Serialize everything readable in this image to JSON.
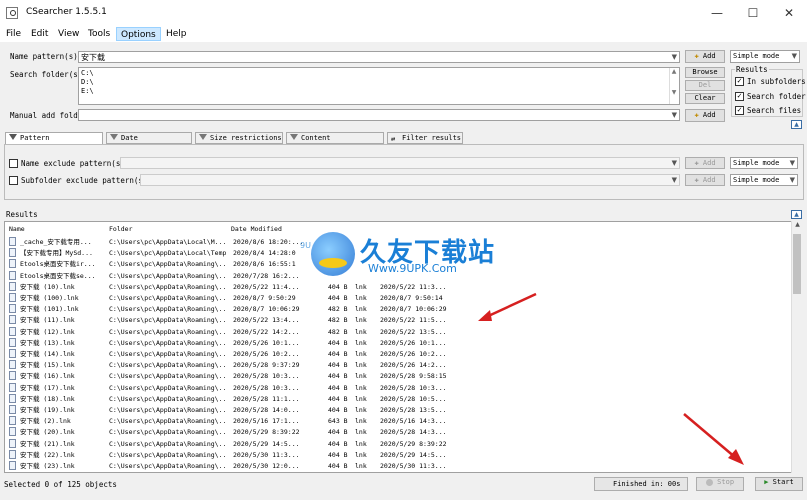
{
  "window": {
    "title": "CSearcher 1.5.5.1",
    "controls": [
      "—",
      "☐",
      "✕"
    ]
  },
  "menu": [
    "File",
    "Edit",
    "View",
    "Tools",
    "Options",
    "Help"
  ],
  "form": {
    "name_pattern_label": "Name pattern(s):",
    "name_pattern_value": "安下载",
    "search_folder_label": "Search folder(s):",
    "search_folders": [
      "C:\\",
      "D:\\",
      "E:\\"
    ],
    "manual_folder_label": "Manual add folder",
    "add_label": "Add",
    "browse_label": "Browse",
    "del_label": "Del",
    "clear_label": "Clear",
    "add2_label": "Add",
    "mode_value": "Simple mode",
    "results_group_label": "Results",
    "in_subfolders_label": "In subfolders",
    "search_folder_opt_label": "Search folder",
    "search_files_label": "Search files"
  },
  "tabs": [
    "Pattern restrictions",
    "Date restrictions",
    "Size restrictions",
    "Content restrictions",
    "Filter results"
  ],
  "pattern_restrictions": {
    "name_exclude_label": "Name exclude pattern(s):",
    "subfolder_exclude_label": "Subfolder exclude pattern(s):",
    "add_label": "Add",
    "mode_value": "Simple mode"
  },
  "results": {
    "label": "Results",
    "columns": [
      "Name",
      "Folder",
      "Date Modified"
    ],
    "rows": [
      {
        "name": "_cache_安下载专用...",
        "folder": "C:\\Users\\pc\\AppData\\Local\\M...",
        "date": "2020/8/6 18:20:...",
        "size": "",
        "type": "",
        "date2": ""
      },
      {
        "name": "【安下载专用】MySd...",
        "folder": "C:\\Users\\pc\\AppData\\Local\\Temp",
        "date": "2020/8/4 14:28:0",
        "size": "",
        "type": "",
        "date2": ""
      },
      {
        "name": "Etools桌面安下载ir...",
        "folder": "C:\\Users\\pc\\AppData\\Roaming\\...",
        "date": "2020/8/6 16:55:1",
        "size": "",
        "type": "",
        "date2": ""
      },
      {
        "name": "Etools桌面安下载se...",
        "folder": "C:\\Users\\pc\\AppData\\Roaming\\...",
        "date": "2020/7/28 16:2...",
        "size": "",
        "type": "",
        "date2": ""
      },
      {
        "name": "安下载 (10).lnk",
        "folder": "C:\\Users\\pc\\AppData\\Roaming\\...",
        "date": "2020/5/22 11:4...",
        "size": "404 B",
        "type": "lnk",
        "date2": "2020/5/22 11:3..."
      },
      {
        "name": "安下载 (100).lnk",
        "folder": "C:\\Users\\pc\\AppData\\Roaming\\...",
        "date": "2020/8/7 9:50:29",
        "size": "404 B",
        "type": "lnk",
        "date2": "2020/8/7 9:50:14"
      },
      {
        "name": "安下载 (101).lnk",
        "folder": "C:\\Users\\pc\\AppData\\Roaming\\...",
        "date": "2020/8/7 10:06:29",
        "size": "482 B",
        "type": "lnk",
        "date2": "2020/8/7 10:06:29"
      },
      {
        "name": "安下载 (11).lnk",
        "folder": "C:\\Users\\pc\\AppData\\Roaming\\...",
        "date": "2020/5/22 13:4...",
        "size": "482 B",
        "type": "lnk",
        "date2": "2020/5/22 11:5..."
      },
      {
        "name": "安下载 (12).lnk",
        "folder": "C:\\Users\\pc\\AppData\\Roaming\\...",
        "date": "2020/5/22 14:2...",
        "size": "482 B",
        "type": "lnk",
        "date2": "2020/5/22 13:5..."
      },
      {
        "name": "安下载 (13).lnk",
        "folder": "C:\\Users\\pc\\AppData\\Roaming\\...",
        "date": "2020/5/26 10:1...",
        "size": "404 B",
        "type": "lnk",
        "date2": "2020/5/26 10:1..."
      },
      {
        "name": "安下载 (14).lnk",
        "folder": "C:\\Users\\pc\\AppData\\Roaming\\...",
        "date": "2020/5/26 10:2...",
        "size": "404 B",
        "type": "lnk",
        "date2": "2020/5/26 10:2..."
      },
      {
        "name": "安下载 (15).lnk",
        "folder": "C:\\Users\\pc\\AppData\\Roaming\\...",
        "date": "2020/5/28 9:37:29",
        "size": "404 B",
        "type": "lnk",
        "date2": "2020/5/26 14:2..."
      },
      {
        "name": "安下载 (16).lnk",
        "folder": "C:\\Users\\pc\\AppData\\Roaming\\...",
        "date": "2020/5/28 10:3...",
        "size": "404 B",
        "type": "lnk",
        "date2": "2020/5/28 9:58:15"
      },
      {
        "name": "安下载 (17).lnk",
        "folder": "C:\\Users\\pc\\AppData\\Roaming\\...",
        "date": "2020/5/28 10:3...",
        "size": "404 B",
        "type": "lnk",
        "date2": "2020/5/28 10:3..."
      },
      {
        "name": "安下载 (18).lnk",
        "folder": "C:\\Users\\pc\\AppData\\Roaming\\...",
        "date": "2020/5/28 11:1...",
        "size": "404 B",
        "type": "lnk",
        "date2": "2020/5/28 10:5..."
      },
      {
        "name": "安下载 (19).lnk",
        "folder": "C:\\Users\\pc\\AppData\\Roaming\\...",
        "date": "2020/5/28 14:0...",
        "size": "404 B",
        "type": "lnk",
        "date2": "2020/5/28 13:5..."
      },
      {
        "name": "安下载 (2).lnk",
        "folder": "C:\\Users\\pc\\AppData\\Roaming\\...",
        "date": "2020/5/16 17:1...",
        "size": "643 B",
        "type": "lnk",
        "date2": "2020/5/16 14:3..."
      },
      {
        "name": "安下载 (20).lnk",
        "folder": "C:\\Users\\pc\\AppData\\Roaming\\...",
        "date": "2020/5/29 8:39:22",
        "size": "404 B",
        "type": "lnk",
        "date2": "2020/5/28 14:3..."
      },
      {
        "name": "安下载 (21).lnk",
        "folder": "C:\\Users\\pc\\AppData\\Roaming\\...",
        "date": "2020/5/29 14:5...",
        "size": "404 B",
        "type": "lnk",
        "date2": "2020/5/29 8:39:22"
      },
      {
        "name": "安下载 (22).lnk",
        "folder": "C:\\Users\\pc\\AppData\\Roaming\\...",
        "date": "2020/5/30 11:3...",
        "size": "404 B",
        "type": "lnk",
        "date2": "2020/5/29 14:5..."
      },
      {
        "name": "安下载 (23).lnk",
        "folder": "C:\\Users\\pc\\AppData\\Roaming\\...",
        "date": "2020/5/30 12:0...",
        "size": "404 B",
        "type": "lnk",
        "date2": "2020/5/30 11:3..."
      }
    ]
  },
  "status": {
    "selected_text": "Selected 0 of 125 objects",
    "finished_text": "Finished in: 00s",
    "stop_label": "Stop",
    "start_label": "Start"
  },
  "watermark": {
    "cn": "久友下载站",
    "url": "Www.9UPK.Com",
    "partial": "9U"
  },
  "colors": {
    "menu_active": "#cde8ff",
    "watermark_blue": "#1a7fd6",
    "arrow_red": "#d62020"
  }
}
